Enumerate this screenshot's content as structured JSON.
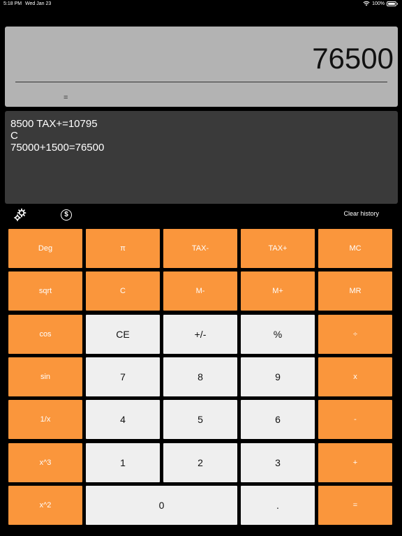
{
  "status_bar": {
    "time": "5:18 PM",
    "date": "Wed Jan 23",
    "battery": "100%"
  },
  "display": {
    "value": "76500",
    "operator": "="
  },
  "history": {
    "lines": [
      "8500 TAX+=10795",
      "C",
      "75000+1500=76500"
    ]
  },
  "toolbar": {
    "settings_icon": "gear-icon",
    "currency_icon": "dollar-icon",
    "currency_glyph": "$",
    "clear_history_label": "Clear history"
  },
  "colors": {
    "accent": "#fa963c",
    "light_key": "#efefef",
    "display_bg": "#b3b3b3",
    "history_bg": "#3a3a3a"
  },
  "keys": {
    "deg": "Deg",
    "pi": "π",
    "tax_minus": "TAX-",
    "tax_plus": "TAX+",
    "mc": "MC",
    "sqrt": "sqrt",
    "c": "C",
    "m_minus": "M-",
    "m_plus": "M+",
    "mr": "MR",
    "cos": "cos",
    "ce": "CE",
    "plus_minus": "+/-",
    "percent": "%",
    "divide": "÷",
    "sin": "sin",
    "seven": "7",
    "eight": "8",
    "nine": "9",
    "multiply": "x",
    "reciprocal": "1/x",
    "four": "4",
    "five": "5",
    "six": "6",
    "minus": "-",
    "cube": "x^3",
    "one": "1",
    "two": "2",
    "three": "3",
    "plus": "+",
    "square": "x^2",
    "zero": "0",
    "decimal": ".",
    "equals": "="
  }
}
